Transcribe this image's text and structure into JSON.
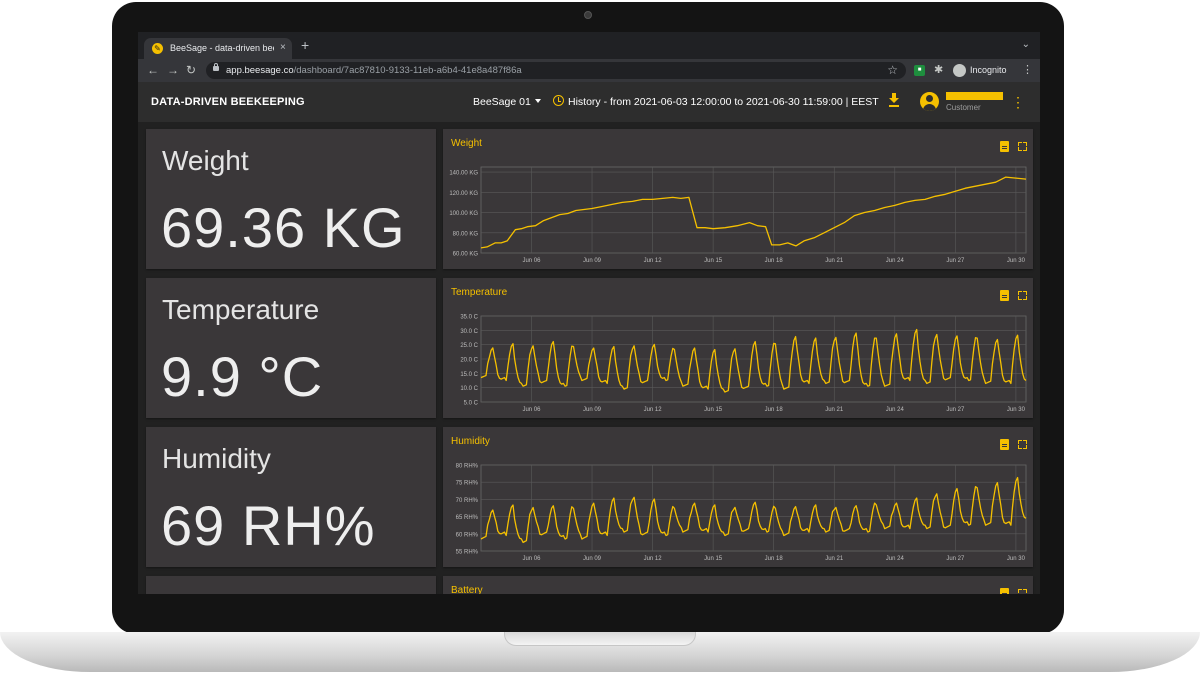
{
  "browser": {
    "tab_title": "BeeSage - data-driven beekeeping",
    "url_host": "app.beesage.co",
    "url_path": "/dashboard/7ac87810-9133-11eb-a6b4-41e8a487f86a",
    "incognito_label": "Incognito",
    "new_tab": "+",
    "close": "×"
  },
  "appbar": {
    "brand": "DATA-DRIVEN BEEKEEPING",
    "device": "BeeSage 01",
    "history": "History - from 2021-06-03 12:00:00 to 2021-06-30 11:59:00 | EEST",
    "user_role": "Customer"
  },
  "metrics": [
    {
      "title": "Weight",
      "value": "69.36 KG"
    },
    {
      "title": "Temperature",
      "value": "9.9 °C"
    },
    {
      "title": "Humidity",
      "value": "69 RH%"
    }
  ],
  "colors": {
    "accent": "#f5c000",
    "card": "#3a3739",
    "background": "#212121",
    "appbar": "#2d2d2d"
  },
  "chart_data": [
    {
      "type": "line",
      "title": "Weight",
      "x_ticks": [
        "Jun 06",
        "Jun 09",
        "Jun 12",
        "Jun 15",
        "Jun 18",
        "Jun 21",
        "Jun 24",
        "Jun 27",
        "Jun 30"
      ],
      "y_ticks": [
        "60.00 KG",
        "80.00 KG",
        "100.00 KG",
        "120.00 KG",
        "140.00 KG"
      ],
      "ylim": [
        60,
        145
      ],
      "xlim": [
        3.5,
        30.5
      ],
      "grid": true,
      "series": [
        {
          "color": "#f5c000",
          "x": [
            3.5,
            3.8,
            4.2,
            4.5,
            4.8,
            5.2,
            5.5,
            5.8,
            6.2,
            6.6,
            7.0,
            7.4,
            7.8,
            8.2,
            8.6,
            9.0,
            9.5,
            10.0,
            10.5,
            11.0,
            11.5,
            12.0,
            12.5,
            13.0,
            13.4,
            13.8,
            14.2,
            14.6,
            15.0,
            15.6,
            16.2,
            16.8,
            17.2,
            17.6,
            17.9,
            18.3,
            18.7,
            19.1,
            19.5,
            20.0,
            20.5,
            21.0,
            21.5,
            22.0,
            22.5,
            23.0,
            23.5,
            24.0,
            24.5,
            25.0,
            25.5,
            26.0,
            26.5,
            27.0,
            27.5,
            28.0,
            28.5,
            29.0,
            29.5,
            30.0,
            30.5
          ],
          "values": [
            65,
            66,
            70,
            70,
            72,
            83,
            84,
            86,
            87,
            92,
            95,
            98,
            99,
            102,
            103,
            104,
            106,
            108,
            110,
            111,
            113,
            113,
            114,
            115,
            114,
            115,
            85,
            85,
            84,
            85,
            87,
            90,
            87,
            86,
            68,
            68,
            70,
            67,
            72,
            75,
            80,
            85,
            90,
            97,
            100,
            102,
            105,
            107,
            110,
            112,
            113,
            116,
            118,
            121,
            124,
            126,
            128,
            130,
            135,
            134,
            133
          ]
        }
      ]
    },
    {
      "type": "line",
      "title": "Temperature",
      "x_ticks": [
        "Jun 06",
        "Jun 09",
        "Jun 12",
        "Jun 15",
        "Jun 18",
        "Jun 21",
        "Jun 24",
        "Jun 27",
        "Jun 30"
      ],
      "y_ticks": [
        "5.0 C",
        "10.0 C",
        "15.0 C",
        "20.0 C",
        "25.0 C",
        "30.0 C",
        "35.0 C"
      ],
      "ylim": [
        5,
        35
      ],
      "xlim": [
        3.5,
        30.5
      ],
      "grid": true,
      "series": [
        {
          "color": "#f5c000",
          "day_min": [
            14,
            13,
            11,
            12,
            11,
            13,
            12,
            10,
            12,
            13,
            11,
            10,
            9,
            10,
            11,
            10,
            12,
            12,
            12,
            11,
            11,
            13,
            12,
            13,
            13,
            12,
            12,
            12
          ],
          "day_max": [
            24,
            25,
            25,
            26,
            25,
            24,
            24,
            25,
            25,
            24,
            24,
            23,
            24,
            26,
            26,
            28,
            27,
            28,
            29,
            28,
            29,
            30,
            29,
            28,
            28,
            27,
            28,
            27
          ]
        }
      ]
    },
    {
      "type": "line",
      "title": "Humidity",
      "x_ticks": [
        "Jun 06",
        "Jun 09",
        "Jun 12",
        "Jun 15",
        "Jun 18",
        "Jun 21",
        "Jun 24",
        "Jun 27",
        "Jun 30"
      ],
      "y_ticks": [
        "55 RH%",
        "60 RH%",
        "65 RH%",
        "70 RH%",
        "75 RH%",
        "80 RH%"
      ],
      "ylim": [
        55,
        80
      ],
      "xlim": [
        3.5,
        30.5
      ],
      "grid": true,
      "series": [
        {
          "color": "#f5c000",
          "day_min": [
            59,
            60,
            58,
            60,
            59,
            59,
            60,
            61,
            60,
            60,
            61,
            61,
            60,
            61,
            61,
            60,
            61,
            61,
            61,
            61,
            62,
            62,
            62,
            62,
            63,
            63,
            63,
            64
          ],
          "day_max": [
            67,
            68,
            68,
            68,
            68,
            69,
            70,
            71,
            70,
            68,
            69,
            68,
            68,
            69,
            68,
            68,
            68,
            68,
            68,
            69,
            69,
            70,
            72,
            73,
            74,
            75,
            76,
            77
          ]
        }
      ]
    },
    {
      "type": "line",
      "title": "Battery"
    }
  ]
}
